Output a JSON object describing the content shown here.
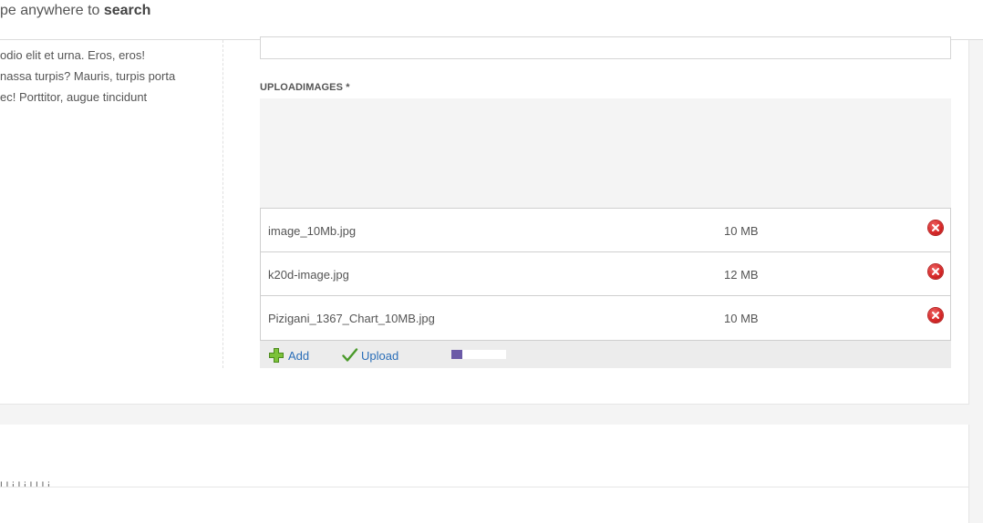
{
  "header": {
    "search_hint_prefix": "pe anywhere to ",
    "search_hint_bold": "search"
  },
  "left_column": {
    "lines": [
      "odio elit et urna. Eros, eros!",
      "nassa turpis? Mauris, turpis porta",
      "ec! Porttitor, augue tincidunt"
    ]
  },
  "upload": {
    "label": "UPLOADIMAGES",
    "required_marker": "*",
    "files": [
      {
        "name": "image_10Mb.jpg",
        "size": "10 MB"
      },
      {
        "name": "k20d-image.jpg",
        "size": "12 MB"
      },
      {
        "name": "Pizigani_1367_Chart_10MB.jpg",
        "size": "10 MB"
      }
    ],
    "add_label": "Add",
    "upload_label": "Upload",
    "progress_percent": 20
  },
  "lower_section": {
    "cut_text": "l    l         i      l   i  l   l  l  i"
  },
  "colors": {
    "link": "#2a6eb8",
    "progress_fill": "#6b5aa7",
    "remove": "#d42424",
    "add_icon": "#6cab2b",
    "upload_icon": "#4a9a2a"
  },
  "icons": {
    "remove": "remove-icon",
    "add": "plus-icon",
    "upload": "checkmark-icon"
  }
}
